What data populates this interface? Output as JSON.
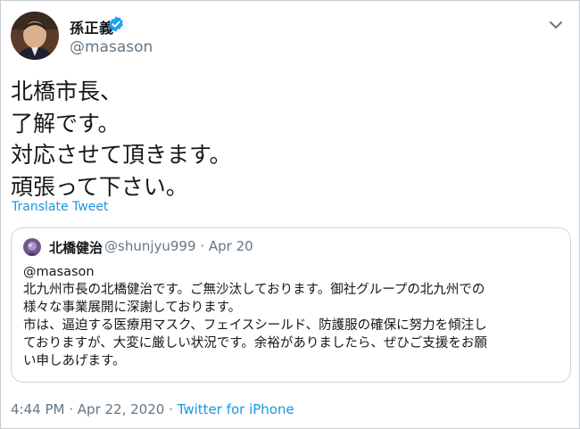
{
  "author": {
    "display_name": "孫正義",
    "handle": "@masason",
    "verified_icon": "verified-badge-icon",
    "verified_color": "#1da1f2"
  },
  "tweet": {
    "lines": [
      "北橋市長、",
      "了解です。",
      "対応させて頂きます。",
      "頑張って下さい。"
    ],
    "translate_label": "Translate Tweet"
  },
  "quoted_tweet": {
    "display_name": "北橋健治",
    "handle": "@shunjyu999",
    "separator": "·",
    "date": "Apr 20",
    "lines": [
      "@masason",
      "北九州市長の北橋健治です。ご無沙汰しております。御社グループの北九州での",
      "様々な事業展開に深謝しております。",
      "市は、逼迫する医療用マスク、フェイスシールド、防護服の確保に努力を傾注し",
      "ておりますが、大変に厳しい状況です。余裕がありましたら、ぜひご支援をお願",
      "い申しあげます。"
    ]
  },
  "footer": {
    "time": "4:44 PM",
    "sep1": "·",
    "date": "Apr 22, 2020",
    "sep2": "·",
    "source": "Twitter for iPhone"
  },
  "colors": {
    "link": "#1b95e0",
    "secondary_text": "#657786",
    "border": "#ccd6dd"
  }
}
